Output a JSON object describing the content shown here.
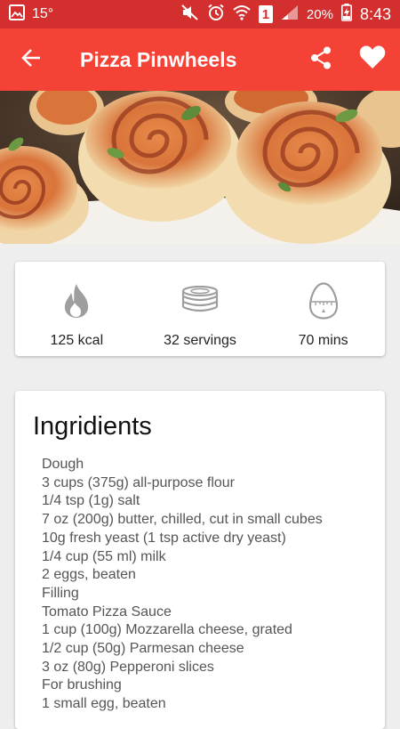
{
  "status_bar": {
    "temperature": "15°",
    "sim_badge": "1",
    "battery_percent": "20%",
    "time": "8:43"
  },
  "app_bar": {
    "title": "Pizza Pinwheels",
    "back_icon": "arrow-back-icon",
    "share_icon": "share-icon",
    "favorite_icon": "heart-icon"
  },
  "stats": [
    {
      "icon": "flame-icon",
      "value": "125 kcal"
    },
    {
      "icon": "plates-stack-icon",
      "value": "32 servings"
    },
    {
      "icon": "egg-timer-icon",
      "value": "70 mins"
    }
  ],
  "ingredients": {
    "title": "Ingridients",
    "items": [
      "Dough",
      "3 cups (375g) all-purpose flour",
      "1/4 tsp (1g) salt",
      "7 oz (200g) butter, chilled, cut in small cubes",
      "10g fresh yeast (1 tsp active dry yeast)",
      "1/4 cup (55 ml) milk",
      "2 eggs, beaten",
      "Filling",
      "Tomato Pizza Sauce",
      "1 cup (100g) Mozzarella cheese, grated",
      "1/2 cup (50g) Parmesan cheese",
      "3 oz (80g) Pepperoni slices",
      "For brushing",
      "1 small egg, beaten"
    ]
  },
  "colors": {
    "status_bar": "#d32f2f",
    "app_bar": "#f44336",
    "background": "#eeeeee",
    "icon_gray": "#9e9e9e"
  }
}
